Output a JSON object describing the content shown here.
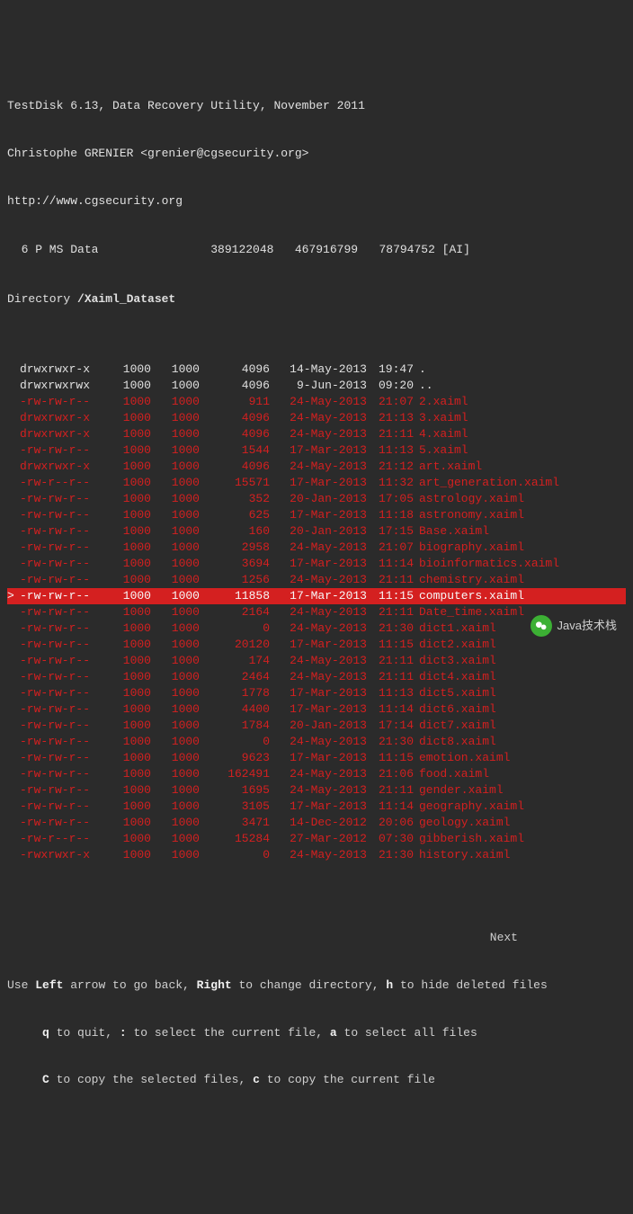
{
  "header": {
    "title": "TestDisk 6.13, Data Recovery Utility, November 2011",
    "author": "Christophe GRENIER <grenier@cgsecurity.org>",
    "url": "http://www.cgsecurity.org",
    "partition": "  6 P MS Data                389122048   467916799   78794752 [AI]",
    "dir_label": "Directory ",
    "dir_path": "/Xaiml_Dataset"
  },
  "listing": [
    {
      "sel": false,
      "del": false,
      "perms": "drwxrwxr-x",
      "uid": "1000",
      "gid": "1000",
      "size": "4096",
      "date": "14-May-2013",
      "time": "19:47",
      "name": "."
    },
    {
      "sel": false,
      "del": false,
      "perms": "drwxrwxrwx",
      "uid": "1000",
      "gid": "1000",
      "size": "4096",
      "date": " 9-Jun-2013",
      "time": "09:20",
      "name": ".."
    },
    {
      "sel": false,
      "del": true,
      "perms": "-rw-rw-r--",
      "uid": "1000",
      "gid": "1000",
      "size": "911",
      "date": "24-May-2013",
      "time": "21:07",
      "name": "2.xaiml"
    },
    {
      "sel": false,
      "del": true,
      "perms": "drwxrwxr-x",
      "uid": "1000",
      "gid": "1000",
      "size": "4096",
      "date": "24-May-2013",
      "time": "21:13",
      "name": "3.xaiml"
    },
    {
      "sel": false,
      "del": true,
      "perms": "drwxrwxr-x",
      "uid": "1000",
      "gid": "1000",
      "size": "4096",
      "date": "24-May-2013",
      "time": "21:11",
      "name": "4.xaiml"
    },
    {
      "sel": false,
      "del": true,
      "perms": "-rw-rw-r--",
      "uid": "1000",
      "gid": "1000",
      "size": "1544",
      "date": "17-Mar-2013",
      "time": "11:13",
      "name": "5.xaiml"
    },
    {
      "sel": false,
      "del": true,
      "perms": "drwxrwxr-x",
      "uid": "1000",
      "gid": "1000",
      "size": "4096",
      "date": "24-May-2013",
      "time": "21:12",
      "name": "art.xaiml"
    },
    {
      "sel": false,
      "del": true,
      "perms": "-rw-r--r--",
      "uid": "1000",
      "gid": "1000",
      "size": "15571",
      "date": "17-Mar-2013",
      "time": "11:32",
      "name": "art_generation.xaiml"
    },
    {
      "sel": false,
      "del": true,
      "perms": "-rw-rw-r--",
      "uid": "1000",
      "gid": "1000",
      "size": "352",
      "date": "20-Jan-2013",
      "time": "17:05",
      "name": "astrology.xaiml"
    },
    {
      "sel": false,
      "del": true,
      "perms": "-rw-rw-r--",
      "uid": "1000",
      "gid": "1000",
      "size": "625",
      "date": "17-Mar-2013",
      "time": "11:18",
      "name": "astronomy.xaiml"
    },
    {
      "sel": false,
      "del": true,
      "perms": "-rw-rw-r--",
      "uid": "1000",
      "gid": "1000",
      "size": "160",
      "date": "20-Jan-2013",
      "time": "17:15",
      "name": "Base.xaiml"
    },
    {
      "sel": false,
      "del": true,
      "perms": "-rw-rw-r--",
      "uid": "1000",
      "gid": "1000",
      "size": "2958",
      "date": "24-May-2013",
      "time": "21:07",
      "name": "biography.xaiml"
    },
    {
      "sel": false,
      "del": true,
      "perms": "-rw-rw-r--",
      "uid": "1000",
      "gid": "1000",
      "size": "3694",
      "date": "17-Mar-2013",
      "time": "11:14",
      "name": "bioinformatics.xaiml"
    },
    {
      "sel": false,
      "del": true,
      "perms": "-rw-rw-r--",
      "uid": "1000",
      "gid": "1000",
      "size": "1256",
      "date": "24-May-2013",
      "time": "21:11",
      "name": "chemistry.xaiml"
    },
    {
      "sel": true,
      "del": true,
      "perms": "-rw-rw-r--",
      "uid": "1000",
      "gid": "1000",
      "size": "11858",
      "date": "17-Mar-2013",
      "time": "11:15",
      "name": "computers.xaiml"
    },
    {
      "sel": false,
      "del": true,
      "perms": "-rw-rw-r--",
      "uid": "1000",
      "gid": "1000",
      "size": "2164",
      "date": "24-May-2013",
      "time": "21:11",
      "name": "Date_time.xaiml"
    },
    {
      "sel": false,
      "del": true,
      "perms": "-rw-rw-r--",
      "uid": "1000",
      "gid": "1000",
      "size": "0",
      "date": "24-May-2013",
      "time": "21:30",
      "name": "dict1.xaiml"
    },
    {
      "sel": false,
      "del": true,
      "perms": "-rw-rw-r--",
      "uid": "1000",
      "gid": "1000",
      "size": "20120",
      "date": "17-Mar-2013",
      "time": "11:15",
      "name": "dict2.xaiml"
    },
    {
      "sel": false,
      "del": true,
      "perms": "-rw-rw-r--",
      "uid": "1000",
      "gid": "1000",
      "size": "174",
      "date": "24-May-2013",
      "time": "21:11",
      "name": "dict3.xaiml"
    },
    {
      "sel": false,
      "del": true,
      "perms": "-rw-rw-r--",
      "uid": "1000",
      "gid": "1000",
      "size": "2464",
      "date": "24-May-2013",
      "time": "21:11",
      "name": "dict4.xaiml"
    },
    {
      "sel": false,
      "del": true,
      "perms": "-rw-rw-r--",
      "uid": "1000",
      "gid": "1000",
      "size": "1778",
      "date": "17-Mar-2013",
      "time": "11:13",
      "name": "dict5.xaiml"
    },
    {
      "sel": false,
      "del": true,
      "perms": "-rw-rw-r--",
      "uid": "1000",
      "gid": "1000",
      "size": "4400",
      "date": "17-Mar-2013",
      "time": "11:14",
      "name": "dict6.xaiml"
    },
    {
      "sel": false,
      "del": true,
      "perms": "-rw-rw-r--",
      "uid": "1000",
      "gid": "1000",
      "size": "1784",
      "date": "20-Jan-2013",
      "time": "17:14",
      "name": "dict7.xaiml"
    },
    {
      "sel": false,
      "del": true,
      "perms": "-rw-rw-r--",
      "uid": "1000",
      "gid": "1000",
      "size": "0",
      "date": "24-May-2013",
      "time": "21:30",
      "name": "dict8.xaiml"
    },
    {
      "sel": false,
      "del": true,
      "perms": "-rw-rw-r--",
      "uid": "1000",
      "gid": "1000",
      "size": "9623",
      "date": "17-Mar-2013",
      "time": "11:15",
      "name": "emotion.xaiml"
    },
    {
      "sel": false,
      "del": true,
      "perms": "-rw-rw-r--",
      "uid": "1000",
      "gid": "1000",
      "size": "162491",
      "date": "24-May-2013",
      "time": "21:06",
      "name": "food.xaiml"
    },
    {
      "sel": false,
      "del": true,
      "perms": "-rw-rw-r--",
      "uid": "1000",
      "gid": "1000",
      "size": "1695",
      "date": "24-May-2013",
      "time": "21:11",
      "name": "gender.xaiml"
    },
    {
      "sel": false,
      "del": true,
      "perms": "-rw-rw-r--",
      "uid": "1000",
      "gid": "1000",
      "size": "3105",
      "date": "17-Mar-2013",
      "time": "11:14",
      "name": "geography.xaiml"
    },
    {
      "sel": false,
      "del": true,
      "perms": "-rw-rw-r--",
      "uid": "1000",
      "gid": "1000",
      "size": "3471",
      "date": "14-Dec-2012",
      "time": "20:06",
      "name": "geology.xaiml"
    },
    {
      "sel": false,
      "del": true,
      "perms": "-rw-r--r--",
      "uid": "1000",
      "gid": "1000",
      "size": "15284",
      "date": "27-Mar-2012",
      "time": "07:30",
      "name": "gibberish.xaiml"
    },
    {
      "sel": false,
      "del": true,
      "perms": "-rwxrwxr-x",
      "uid": "1000",
      "gid": "1000",
      "size": "0",
      "date": "24-May-2013",
      "time": "21:30",
      "name": "history.xaiml"
    }
  ],
  "footer": {
    "next": "Next",
    "help1_pre": "Use ",
    "help1_b1": "Left",
    "help1_mid1": " arrow to go back, ",
    "help1_b2": "Right",
    "help1_mid2": " to change directory, ",
    "help1_b3": "h",
    "help1_suf": " to hide deleted files",
    "help2_pad": "     ",
    "help2_b1": "q",
    "help2_mid1": " to quit, ",
    "help2_b2": ":",
    "help2_mid2": " to select the current file, ",
    "help2_b3": "a",
    "help2_suf": " to select all files",
    "help3_pad": "     ",
    "help3_b1": "C",
    "help3_mid1": " to copy the selected files, ",
    "help3_b2": "c",
    "help3_suf": " to copy the current file"
  },
  "watermark": {
    "text": "Java技术栈"
  }
}
